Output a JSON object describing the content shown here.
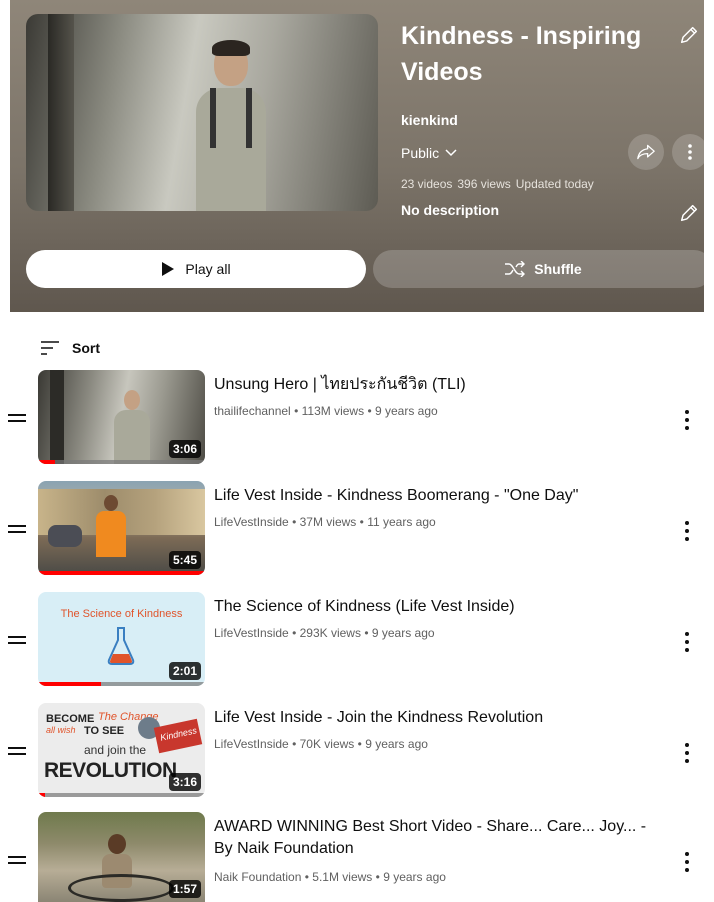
{
  "playlist": {
    "title": "Kindness - Inspiring Videos",
    "channel": "kienkind",
    "privacy": "Public",
    "video_count": "23 videos",
    "views": "396 views",
    "updated": "Updated today",
    "description": "No description"
  },
  "actions": {
    "play_all": "Play all",
    "shuffle": "Shuffle"
  },
  "sort_label": "Sort",
  "videos": [
    {
      "title": "Unsung Hero | ไทยประกันชีวิต (TLI)",
      "channel": "thailifechannel",
      "views": "113M views",
      "age": "9 years ago",
      "duration": "3:06",
      "progress": 0.1
    },
    {
      "title": "Life Vest Inside - Kindness Boomerang - \"One Day\"",
      "channel": "LifeVestInside",
      "views": "37M views",
      "age": "11 years ago",
      "duration": "5:45",
      "progress": 1.0
    },
    {
      "title": "The Science of Kindness (Life Vest Inside)",
      "channel": "LifeVestInside",
      "views": "293K views",
      "age": "9 years ago",
      "duration": "2:01",
      "progress": 0.38
    },
    {
      "title": "Life Vest Inside - Join the Kindness Revolution",
      "channel": "LifeVestInside",
      "views": "70K views",
      "age": "9 years ago",
      "duration": "3:16",
      "progress": 0.04
    },
    {
      "title": "AWARD WINNING Best Short Video - Share... Care... Joy... - By Naik Foundation",
      "channel": "Naik Foundation",
      "views": "5.1M views",
      "age": "9 years ago",
      "duration": "1:57",
      "progress": 0.0
    }
  ],
  "thumb_texts": {
    "science": "The Science of Kindness",
    "rev_become": "BECOME",
    "rev_change": "The Change",
    "rev_wish": "all wish",
    "rev_tosee": "TO SEE",
    "rev_join": "and join the",
    "rev_revolution": "REVOLUTION",
    "rev_kindness": "Kindness"
  },
  "separator": "•"
}
